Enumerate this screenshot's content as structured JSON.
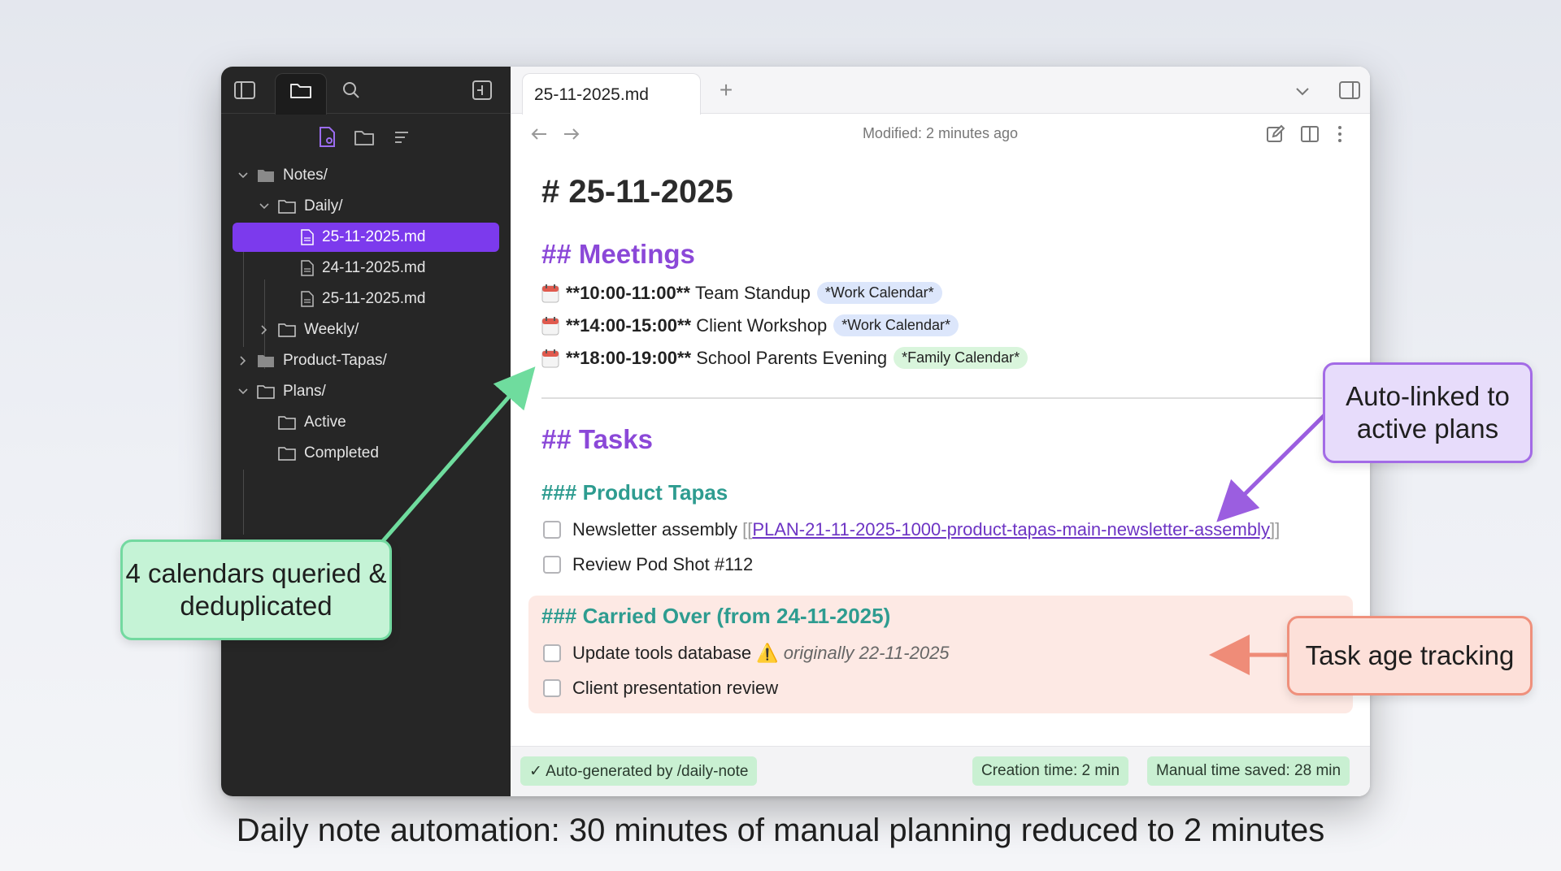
{
  "sidebar": {
    "tree": [
      {
        "label": "Notes/",
        "kind": "folder",
        "expanded": true
      },
      {
        "label": "Daily/",
        "kind": "folder",
        "expanded": true
      },
      {
        "label": "25-11-2025.md",
        "kind": "file",
        "active": true
      },
      {
        "label": "24-11-2025.md",
        "kind": "file"
      },
      {
        "label": "25-11-2025.md",
        "kind": "file"
      },
      {
        "label": "Weekly/",
        "kind": "folder",
        "expanded": false
      },
      {
        "label": "Product-Tapas/",
        "kind": "folder",
        "expanded": false
      },
      {
        "label": "Plans/",
        "kind": "folder",
        "expanded": true
      },
      {
        "label": "Active",
        "kind": "folder"
      },
      {
        "label": "Completed",
        "kind": "folder"
      }
    ]
  },
  "tab": {
    "title": "25-11-2025.md",
    "new_tab": "+"
  },
  "toolbar": {
    "modified": "Modified: 2 minutes ago"
  },
  "note": {
    "h1": "# 25-11-2025",
    "meetings_heading": "## Meetings",
    "meetings": [
      {
        "time": "**10:00-11:00**",
        "title": "Team Standup",
        "calendar": "*Work Calendar*",
        "calendar_type": "work"
      },
      {
        "time": "**14:00-15:00**",
        "title": "Client Workshop",
        "calendar": "*Work Calendar*",
        "calendar_type": "work"
      },
      {
        "time": "**18:00-19:00**",
        "title": "School Parents Evening",
        "calendar": "*Family Calendar*",
        "calendar_type": "family"
      }
    ],
    "tasks_heading": "## Tasks",
    "product_heading": "### Product Tapas",
    "product_tasks": [
      {
        "text": "Newsletter assembly",
        "link_open": "[[",
        "link": "PLAN-21-11-2025-1000-product-tapas-main-newsletter-assembly",
        "link_close": "]]"
      },
      {
        "text": "Review Pod Shot #112"
      }
    ],
    "carried_heading": "### Carried Over (from 24-11-2025)",
    "carried_tasks": [
      {
        "text": "Update tools database",
        "warning": "⚠️",
        "note": "originally 22-11-2025"
      },
      {
        "text": "Client presentation review"
      }
    ]
  },
  "status": {
    "auto": "✓ Auto-generated by /daily-note",
    "creation": "Creation time: 2 min",
    "saved": "Manual time saved: 28 min"
  },
  "callouts": {
    "calendars": "4 calendars queried & deduplicated",
    "linked": "Auto-linked to active plans",
    "age": "Task age tracking"
  },
  "caption": "Daily note automation: 30 minutes of manual planning reduced to 2 minutes",
  "colors": {
    "accent": "#7c3aed",
    "heading_purple": "#8b48d8",
    "heading_teal": "#2e9c90",
    "callout_green": "#c5f3d6",
    "callout_purple": "#e7dcfb",
    "callout_salmon": "#fde0d9"
  }
}
